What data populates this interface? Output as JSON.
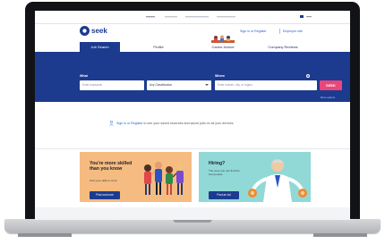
{
  "utility": {
    "items": [
      "",
      "",
      "",
      ""
    ]
  },
  "header": {
    "logo_text": "seek",
    "signin_link": "Sign in or Register",
    "employer_link": "Employer site"
  },
  "tabs": [
    {
      "label": "Job Search",
      "active": true
    },
    {
      "label": "Profile",
      "active": false
    },
    {
      "label": "Career Advice",
      "active": false
    },
    {
      "label": "Company Reviews",
      "active": false
    }
  ],
  "search": {
    "what_label": "What",
    "what_placeholder": "Enter keywords",
    "classification_value": "Any Classification",
    "where_label": "Where",
    "where_placeholder": "Enter suburb, city, or region",
    "submit_label": "SEEK",
    "more_options": "More options"
  },
  "signin_bar": {
    "link": "Sign in or Register",
    "text": " to see your saved searches and saved jobs on all your devices."
  },
  "cards": [
    {
      "title": "You're more skilled than you know",
      "subtitle": "Find your skills to work.",
      "button": "Find out more"
    },
    {
      "title": "Hiring?",
      "subtitle": "The ones you can find the best people",
      "button": "Post an Ad"
    }
  ],
  "colors": {
    "brand_blue": "#1c3b8f",
    "seek_pink": "#e8467c",
    "card_orange": "#f5bb80",
    "card_teal": "#91d9d6",
    "laptop_bezel": "#111317",
    "laptop_base": "#c4c6ca"
  }
}
